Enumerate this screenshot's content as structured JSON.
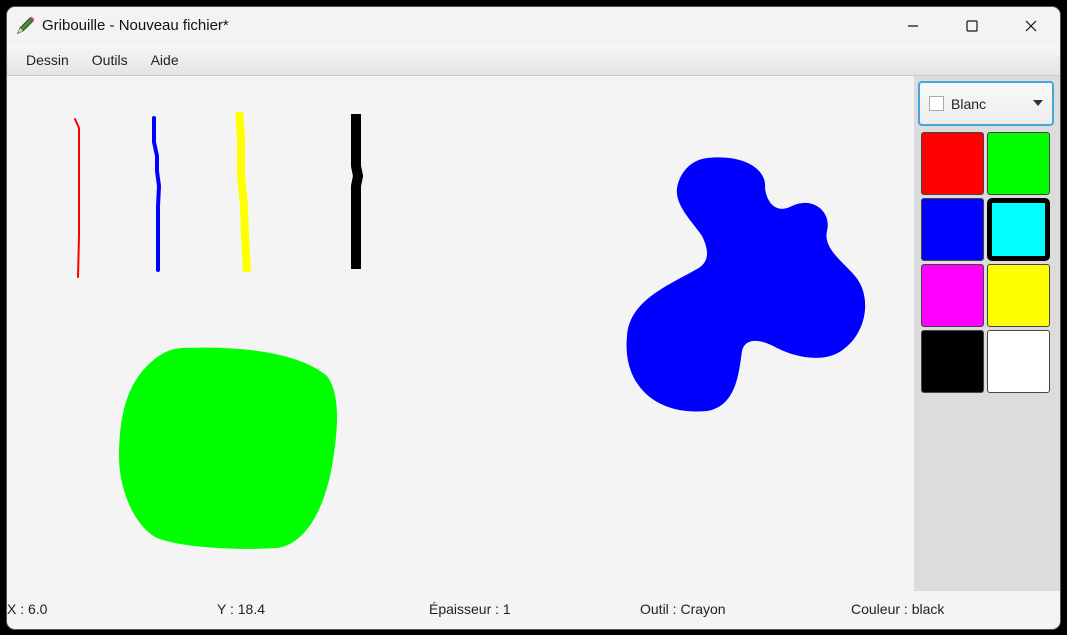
{
  "window": {
    "title": "Gribouille - Nouveau fichier*",
    "app_icon": "pencil-icon",
    "controls": [
      "minimize-icon",
      "maximize-icon",
      "close-icon"
    ]
  },
  "menu": {
    "items": [
      "Dessin",
      "Outils",
      "Aide"
    ]
  },
  "color_selector": {
    "selected_label": "Blanc",
    "selected_color": "#ffffff"
  },
  "palette": [
    {
      "color": "#ff0000",
      "selected": false
    },
    {
      "color": "#00ff00",
      "selected": false
    },
    {
      "color": "#0000ff",
      "selected": false
    },
    {
      "color": "#00ffff",
      "selected": true
    },
    {
      "color": "#ff00ff",
      "selected": false
    },
    {
      "color": "#ffff00",
      "selected": false
    },
    {
      "color": "#000000",
      "selected": false
    },
    {
      "color": "#ffffff",
      "selected": false
    }
  ],
  "drawing": {
    "strokes": [
      {
        "color": "#ff0000",
        "shape": "thin line"
      },
      {
        "color": "#0000ff",
        "shape": "line"
      },
      {
        "color": "#ffff00",
        "shape": "thick line"
      },
      {
        "color": "#000000",
        "shape": "thick line"
      },
      {
        "color": "#00ff00",
        "shape": "filled blob"
      },
      {
        "color": "#0000ff",
        "shape": "filled blob"
      }
    ]
  },
  "status": {
    "x": "X : 6.0",
    "y": "Y : 18.4",
    "thickness": "Épaisseur : 1",
    "tool": "Outil : Crayon",
    "color": "Couleur : black"
  }
}
